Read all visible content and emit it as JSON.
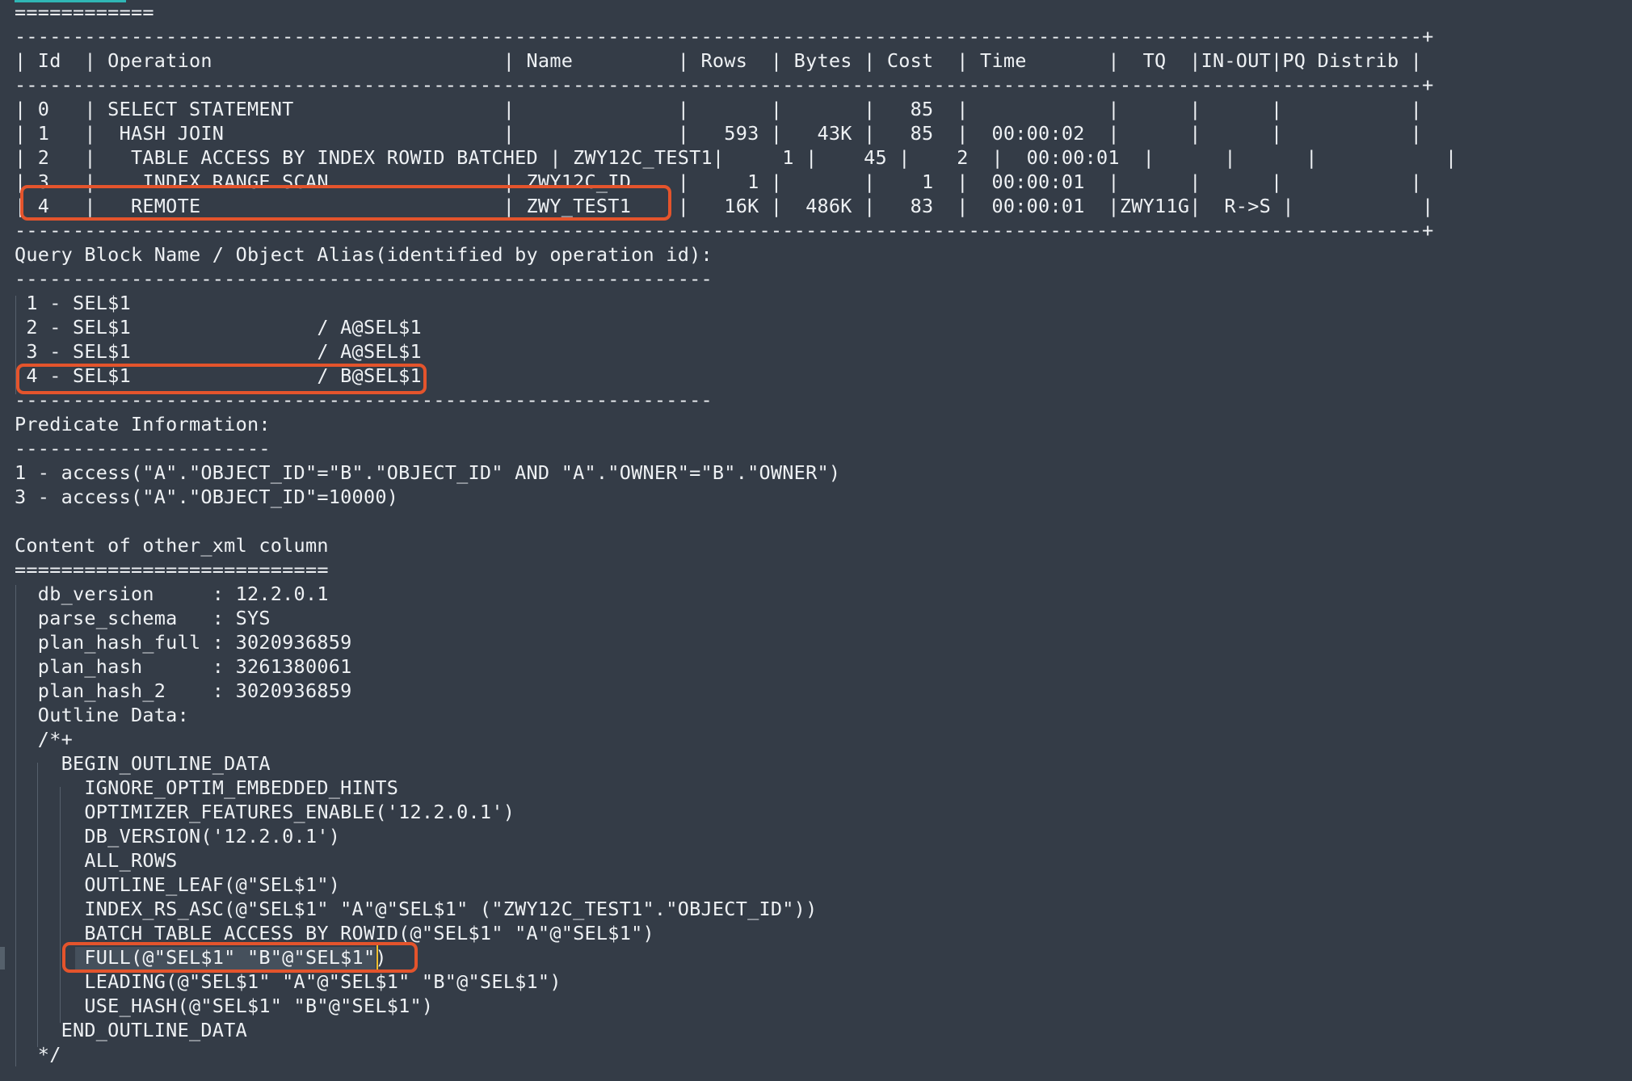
{
  "title_rule": "============",
  "plan_table": {
    "border_line": "-------------------------------------------------------------------------------------------------------------------------+",
    "header_line": "| Id  | Operation                         | Name         | Rows  | Bytes | Cost  | Time       |  TQ  |IN-OUT|PQ Distrib |",
    "rows": [
      "| 0   | SELECT STATEMENT                  |              |       |       |   85  |            |      |      |           |",
      "| 1   |  HASH JOIN                        |              |   593 |   43K |   85  |  00:00:02  |      |      |           |",
      "| 2   |   TABLE ACCESS BY INDEX ROWID BATCHED | ZWY12C_TEST1|     1 |    45 |    2  |  00:00:01  |      |      |           |",
      "| 3   |    INDEX RANGE SCAN               | ZWY12C_ID    |     1 |       |    1  |  00:00:01  |      |      |           |",
      "| 4   |   REMOTE                          | ZWY_TEST1    |   16K |  486K |   83  |  00:00:01  |ZWY11G|  R->S |           |"
    ]
  },
  "query_block": {
    "heading": "Query Block Name / Object Alias(identified by operation id):",
    "rule": "------------------------------------------------------------",
    "rows": [
      " 1 - SEL$1",
      " 2 - SEL$1                / A@SEL$1",
      " 3 - SEL$1                / A@SEL$1",
      " 4 - SEL$1                / B@SEL$1"
    ]
  },
  "predicate": {
    "heading": "Predicate Information:",
    "rule": "----------------------",
    "rows": [
      "1 - access(\"A\".\"OBJECT_ID\"=\"B\".\"OBJECT_ID\" AND \"A\".\"OWNER\"=\"B\".\"OWNER\")",
      "3 - access(\"A\".\"OBJECT_ID\"=10000)"
    ]
  },
  "other_xml": {
    "heading": "Content of other_xml column",
    "rule": "===========================",
    "rows": [
      "  db_version     : 12.2.0.1",
      "  parse_schema   : SYS",
      "  plan_hash_full : 3020936859",
      "  plan_hash      : 3261380061",
      "  plan_hash_2    : 3020936859",
      "  Outline Data:",
      "  /*+",
      "    BEGIN_OUTLINE_DATA",
      "      IGNORE_OPTIM_EMBEDDED_HINTS",
      "      OPTIMIZER_FEATURES_ENABLE('12.2.0.1')",
      "      DB_VERSION('12.2.0.1')",
      "      ALL_ROWS",
      "      OUTLINE_LEAF(@\"SEL$1\")",
      "      INDEX_RS_ASC(@\"SEL$1\" \"A\"@\"SEL$1\" (\"ZWY12C_TEST1\".\"OBJECT_ID\"))",
      "      BATCH_TABLE_ACCESS_BY_ROWID(@\"SEL$1\" \"A\"@\"SEL$1\")",
      "      FULL(@\"SEL$1\" \"B\"@\"SEL$1\")",
      "      LEADING(@\"SEL$1\" \"A\"@\"SEL$1\" \"B\"@\"SEL$1\")",
      "      USE_HASH(@\"SEL$1\" \"B\"@\"SEL$1\")",
      "    END_OUTLINE_DATA",
      "  */"
    ]
  },
  "colors": {
    "background": "#343c47",
    "text": "#eef1f4",
    "highlight_box": "#e4542c",
    "tab_accent": "#2fb6b5",
    "caret": "#f0c030"
  }
}
